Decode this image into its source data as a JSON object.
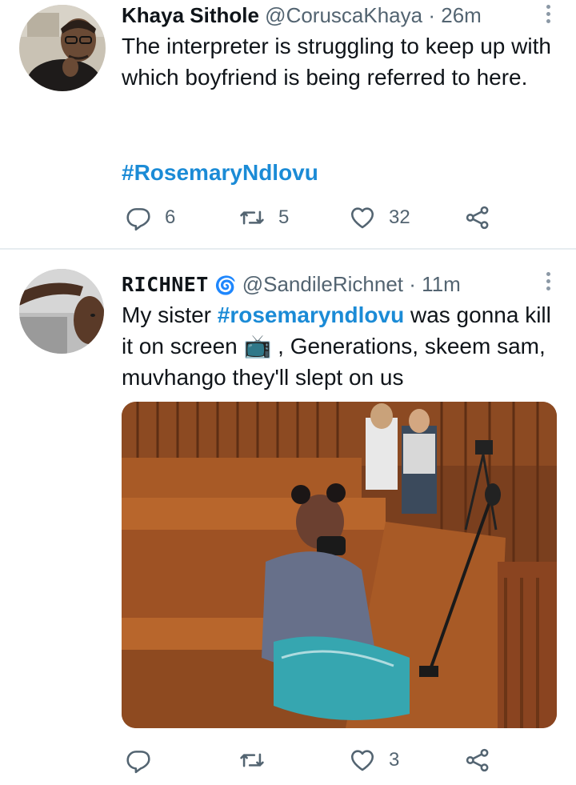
{
  "tweets": [
    {
      "name": "Khaya Sithole",
      "handle": "@CoruscaKhaya",
      "separator": "·",
      "time": "26m",
      "text": "The interpreter is struggling to keep up with which boyfriend is being referred to here.",
      "hashtag": "#RosemaryNdlovu",
      "replies": "6",
      "retweets": "5",
      "likes": "32"
    },
    {
      "name": "RICHNET",
      "name_emoji": "🌀",
      "handle": "@SandileRichnet",
      "separator": "·",
      "time": "11m",
      "text_before": "My sister ",
      "hashtag": "#rosemaryndlovu",
      "text_after": " was gonna kill it on screen 📺 , Generations, skeem sam, muvhango they'll slept on us",
      "replies": "",
      "retweets": "",
      "likes": "3"
    }
  ],
  "icons": {
    "reply": "reply-icon",
    "retweet": "retweet-icon",
    "like": "heart-icon",
    "share": "share-icon",
    "more": "more-options-icon"
  },
  "colors": {
    "hashtag": "#1b8bd6",
    "secondary_text": "#536471",
    "divider": "#e6ecf0"
  }
}
